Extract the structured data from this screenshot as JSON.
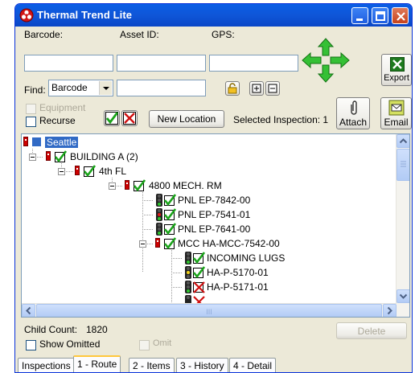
{
  "window": {
    "title": "Thermal Trend Lite"
  },
  "labels": {
    "barcode": "Barcode:",
    "asset_id": "Asset ID:",
    "gps": "GPS:",
    "find": "Find:"
  },
  "inputs": {
    "barcode": "",
    "asset_id": "",
    "gps": "",
    "find_text": ""
  },
  "find_select": {
    "value": "Barcode"
  },
  "toolbar": {
    "export_label": "Export",
    "attach_label": "Attach",
    "email_label": "Email",
    "new_location_label": "New Location",
    "selected_inspection_label": "Selected Inspection: 1"
  },
  "checkboxes": {
    "equipment": "Equipment",
    "recurse": "Recurse",
    "show_omitted": "Show Omitted",
    "omit": "Omit"
  },
  "tree": {
    "root": "Seattle",
    "building": "BUILDING A (2)",
    "floor": "4th FL",
    "room": "4800 MECH. RM",
    "panels": [
      "PNL EP-7842-00",
      "PNL EP-7541-01",
      "PNL EP-7641-00"
    ],
    "mcc": "MCC HA-MCC-7542-00",
    "mcc_children": [
      "INCOMING LUGS",
      "HA-P-5170-01",
      "HA-P-5171-01"
    ],
    "scroll_mid": "III"
  },
  "footer": {
    "child_count_label": "Child Count:",
    "child_count": "1820",
    "delete_label": "Delete"
  },
  "tabs": {
    "inspections": "Inspections",
    "route": "1 - Route",
    "items": "2 - Items",
    "history": "3 - History",
    "detail": "4 - Detail"
  },
  "colors": {
    "titlebar": "#0a5ee6",
    "selection": "#316ac5",
    "check_green": "#1aa31a",
    "cross_red": "#d01010",
    "arrow_green": "#2fb52f"
  }
}
